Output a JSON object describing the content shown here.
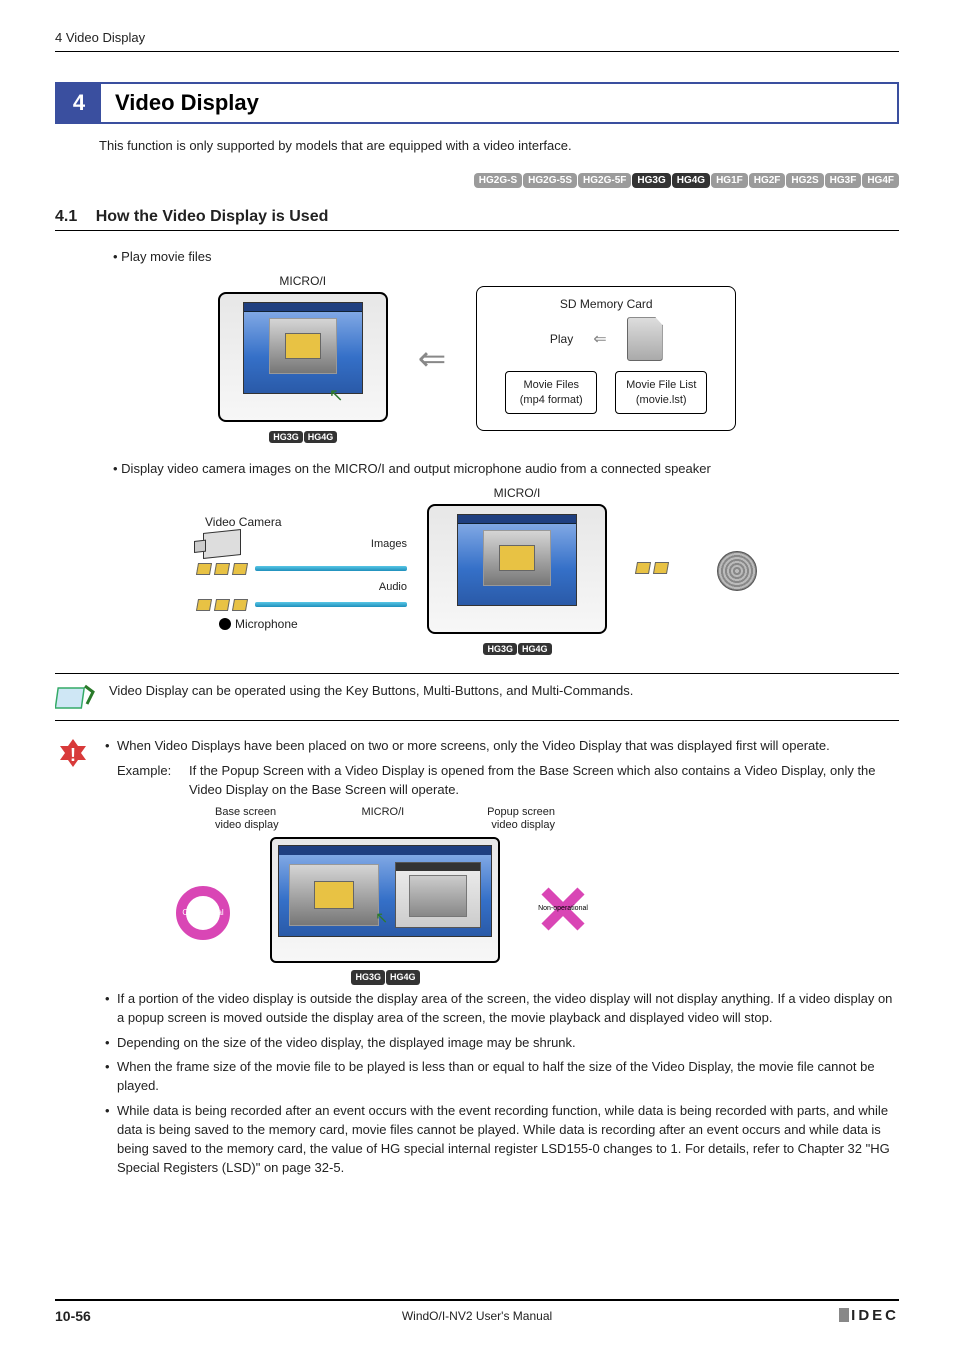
{
  "header": {
    "breadcrumb": "4 Video Display"
  },
  "chapter": {
    "num": "4",
    "title": "Video Display",
    "intro": "This function is only supported by models that are equipped with a video interface."
  },
  "model_badges": [
    {
      "label": "HG2G-S",
      "active": false
    },
    {
      "label": "HG2G-5S",
      "active": false
    },
    {
      "label": "HG2G-5F",
      "active": false
    },
    {
      "label": "HG3G",
      "active": true
    },
    {
      "label": "HG4G",
      "active": true
    },
    {
      "label": "HG1F",
      "active": false
    },
    {
      "label": "HG2F",
      "active": false
    },
    {
      "label": "HG2S",
      "active": false
    },
    {
      "label": "HG3F",
      "active": false
    },
    {
      "label": "HG4F",
      "active": false
    }
  ],
  "section": {
    "num": "4.1",
    "title": "How the Video Display is Used"
  },
  "bullets": {
    "play_movies": "Play movie files",
    "display_camera": "Display video camera images on the MICRO/I and output microphone audio from a connected speaker"
  },
  "fig1": {
    "device_label": "MICRO/I",
    "hg_badges": [
      "HG3G",
      "HG4G"
    ],
    "sdcard_title": "SD Memory Card",
    "play_label": "Play",
    "movie_files": {
      "l1": "Movie Files",
      "l2": "(mp4 format)"
    },
    "movie_list": {
      "l1": "Movie File List",
      "l2": "(movie.lst)"
    }
  },
  "fig2": {
    "device_label": "MICRO/I",
    "video_camera": "Video Camera",
    "images": "Images",
    "audio": "Audio",
    "microphone": "Microphone",
    "hg_badges": [
      "HG3G",
      "HG4G"
    ]
  },
  "note": {
    "text": "Video Display can be operated using the Key Buttons, Multi-Buttons, and Multi-Commands."
  },
  "warning": {
    "items": [
      "When Video Displays have been placed on two or more screens, only the Video Display that was displayed first will operate.",
      "If a portion of the video display is outside the display area of the screen, the video display will not display anything. If a video display on a popup screen is moved outside the display area of the screen, the movie playback and displayed video will stop.",
      "Depending on the size of the video display, the displayed image may be shrunk.",
      "When the frame size of the movie file to be played is less than or equal to half the size of the Video Display, the movie file cannot be played.",
      "While data is being recorded after an event occurs with the event recording function, while data is being recorded with parts, and while data is being saved to the memory card, movie files cannot be played. While data is recording after an event occurs and while data is being saved to the memory card, the value of HG special internal register LSD155-0 changes to 1. For details, refer to Chapter 32 \"HG Special Registers (LSD)\" on page 32-5."
    ],
    "example_label": "Example:",
    "example_text": "If the Popup Screen with a Video Display is opened from the Base Screen which also contains a Video Display, only the Video Display on the Base Screen will operate.",
    "fig3": {
      "device_label": "MICRO/I",
      "base_label_l1": "Base screen",
      "base_label_l2": "video display",
      "popup_label_l1": "Popup screen",
      "popup_label_l2": "video display",
      "operational": "Operational",
      "non_operational": "Non-operational",
      "hg_badges": [
        "HG3G",
        "HG4G"
      ]
    }
  },
  "footer": {
    "page": "10-56",
    "manual": "WindO/I-NV2 User's Manual",
    "brand": "IDEC"
  }
}
